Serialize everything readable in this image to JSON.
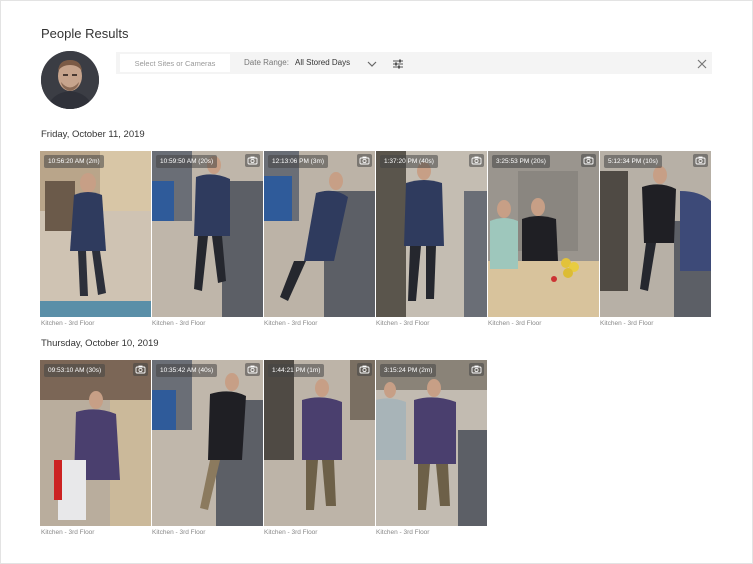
{
  "page": {
    "title": "People Results"
  },
  "toolbar": {
    "site_placeholder": "Select Sites or Cameras",
    "date_label": "Date Range:",
    "date_value": "All Stored Days"
  },
  "groups": [
    {
      "date": "Friday, October 11, 2019",
      "items": [
        {
          "time": "10:56:20 AM (2m)",
          "location": "Kitchen - 3rd Floor"
        },
        {
          "time": "10:59:50 AM (20s)",
          "location": "Kitchen - 3rd Floor"
        },
        {
          "time": "12:13:06 PM (3m)",
          "location": "Kitchen - 3rd Floor"
        },
        {
          "time": "1:37:20 PM (40s)",
          "location": "Kitchen - 3rd Floor"
        },
        {
          "time": "3:25:53 PM (20s)",
          "location": "Kitchen - 3rd Floor"
        },
        {
          "time": "5:12:34 PM (10s)",
          "location": "Kitchen - 3rd Floor"
        }
      ]
    },
    {
      "date": "Thursday, October 10, 2019",
      "items": [
        {
          "time": "09:53:10 AM (30s)",
          "location": "Kitchen - 3rd Floor"
        },
        {
          "time": "10:35:42 AM (40s)",
          "location": "Kitchen - 3rd Floor"
        },
        {
          "time": "1:44:21 PM (1m)",
          "location": "Kitchen - 3rd Floor"
        },
        {
          "time": "3:15:24 PM (2m)",
          "location": "Kitchen - 3rd Floor"
        }
      ]
    }
  ],
  "icons": {
    "camera": "camera-icon",
    "chevron": "chevron-down-icon",
    "filter": "filter-sliders-icon",
    "close": "close-icon"
  },
  "colors": {
    "toolbar_bg": "#f4f4f4",
    "stamp_bg": "#464646"
  }
}
